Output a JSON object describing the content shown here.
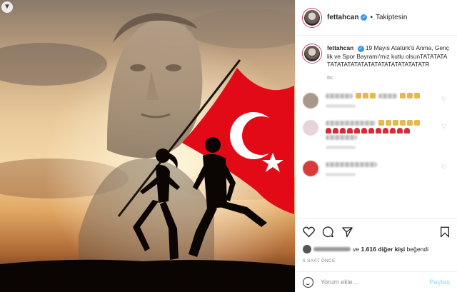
{
  "post": {
    "username": "fettahcan",
    "follow_state": "Takiptesin",
    "separator": "•",
    "caption": "19 Mayıs Atatürk'ü Anma, Gençlik ve Spor Bayramı'mız kutlu olsunTATATATATATATATATATATATATATATATATATATR",
    "caption_age": "6s",
    "likes_connector": "ve",
    "likes_count": "1.616 diğer kişi",
    "likes_suffix": "beğendi",
    "time_ago": "6 SAAT ÖNCE",
    "comment_placeholder": "Yorum ekle...",
    "post_label": "Paylaş"
  },
  "icons": {
    "prev": "chevron-down-icon",
    "verified": "verified-badge-icon",
    "like": "heart-icon",
    "comment": "comment-icon",
    "share": "send-icon",
    "save": "bookmark-icon",
    "emoji": "smiley-icon"
  },
  "comment_avatars": [
    "#a89a8a",
    "#e6d3dc",
    "#d93a3a"
  ],
  "colors": {
    "flag_red": "#e30a17",
    "link_blue": "#3897f0",
    "post_disabled": "#b2dffc"
  }
}
